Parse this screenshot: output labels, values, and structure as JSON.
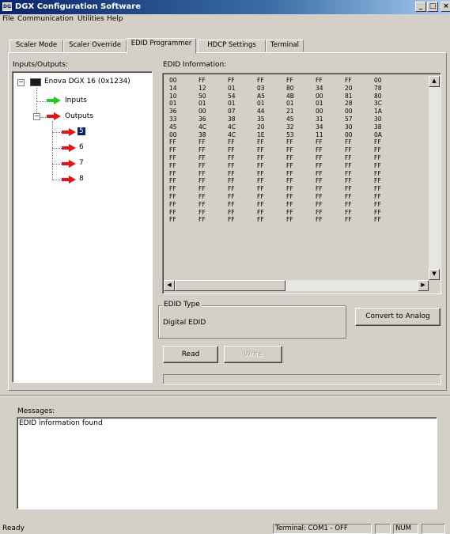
{
  "window": {
    "title": "DGX Configuration Software",
    "icon_text": "DGX",
    "controls": [
      "_",
      "□",
      "×"
    ]
  },
  "menu": [
    "File",
    "Communication",
    "Utilities",
    "Help"
  ],
  "tabs": [
    {
      "label": "Scaler Mode",
      "active": false
    },
    {
      "label": "Scaler Override",
      "active": false
    },
    {
      "label": "EDID Programmer",
      "active": true
    },
    {
      "label": "HDCP Settings",
      "active": false
    },
    {
      "label": "Terminal",
      "active": false
    }
  ],
  "tree": {
    "label": "Inputs/Outputs:",
    "root": "Enova DGX 16 (0x1234)",
    "inputs": "Inputs",
    "outputs": "Outputs",
    "output_items": [
      "5",
      "6",
      "7",
      "8"
    ],
    "selected": "5",
    "colors": {
      "inputs_arrow": "#22cc22",
      "output_arrow": "#ee1111"
    }
  },
  "edid": {
    "label": "EDID Information:",
    "rows": [
      [
        "00",
        "FF",
        "FF",
        "FF",
        "FF",
        "FF",
        "FF",
        "00"
      ],
      [
        "14",
        "12",
        "01",
        "03",
        "80",
        "34",
        "20",
        "78"
      ],
      [
        "10",
        "50",
        "54",
        "A5",
        "4B",
        "00",
        "81",
        "80"
      ],
      [
        "01",
        "01",
        "01",
        "01",
        "01",
        "01",
        "28",
        "3C"
      ],
      [
        "36",
        "00",
        "07",
        "44",
        "21",
        "00",
        "00",
        "1A"
      ],
      [
        "33",
        "36",
        "38",
        "35",
        "45",
        "31",
        "57",
        "30"
      ],
      [
        "45",
        "4C",
        "4C",
        "20",
        "32",
        "34",
        "30",
        "38"
      ],
      [
        "00",
        "38",
        "4C",
        "1E",
        "53",
        "11",
        "00",
        "0A"
      ],
      [
        "FF",
        "FF",
        "FF",
        "FF",
        "FF",
        "FF",
        "FF",
        "FF"
      ],
      [
        "FF",
        "FF",
        "FF",
        "FF",
        "FF",
        "FF",
        "FF",
        "FF"
      ],
      [
        "FF",
        "FF",
        "FF",
        "FF",
        "FF",
        "FF",
        "FF",
        "FF"
      ],
      [
        "FF",
        "FF",
        "FF",
        "FF",
        "FF",
        "FF",
        "FF",
        "FF"
      ],
      [
        "FF",
        "FF",
        "FF",
        "FF",
        "FF",
        "FF",
        "FF",
        "FF"
      ],
      [
        "FF",
        "FF",
        "FF",
        "FF",
        "FF",
        "FF",
        "FF",
        "FF"
      ],
      [
        "FF",
        "FF",
        "FF",
        "FF",
        "FF",
        "FF",
        "FF",
        "FF"
      ],
      [
        "FF",
        "FF",
        "FF",
        "FF",
        "FF",
        "FF",
        "FF",
        "FF"
      ],
      [
        "FF",
        "FF",
        "FF",
        "FF",
        "FF",
        "FF",
        "FF",
        "FF"
      ],
      [
        "FF",
        "FF",
        "FF",
        "FF",
        "FF",
        "FF",
        "FF",
        "FF"
      ],
      [
        "FF",
        "FF",
        "FF",
        "FF",
        "FF",
        "FF",
        "FF",
        "FF"
      ]
    ],
    "type_label": "EDID Type",
    "type_value": "Digital EDID",
    "convert_label": "Convert to Analog",
    "read_label": "Read",
    "write_label": "Write"
  },
  "messages": {
    "label": "Messages:",
    "text": "EDID information found"
  },
  "status": {
    "ready": "Ready",
    "terminal": "Terminal: COM1 - OFF",
    "num": "NUM"
  }
}
